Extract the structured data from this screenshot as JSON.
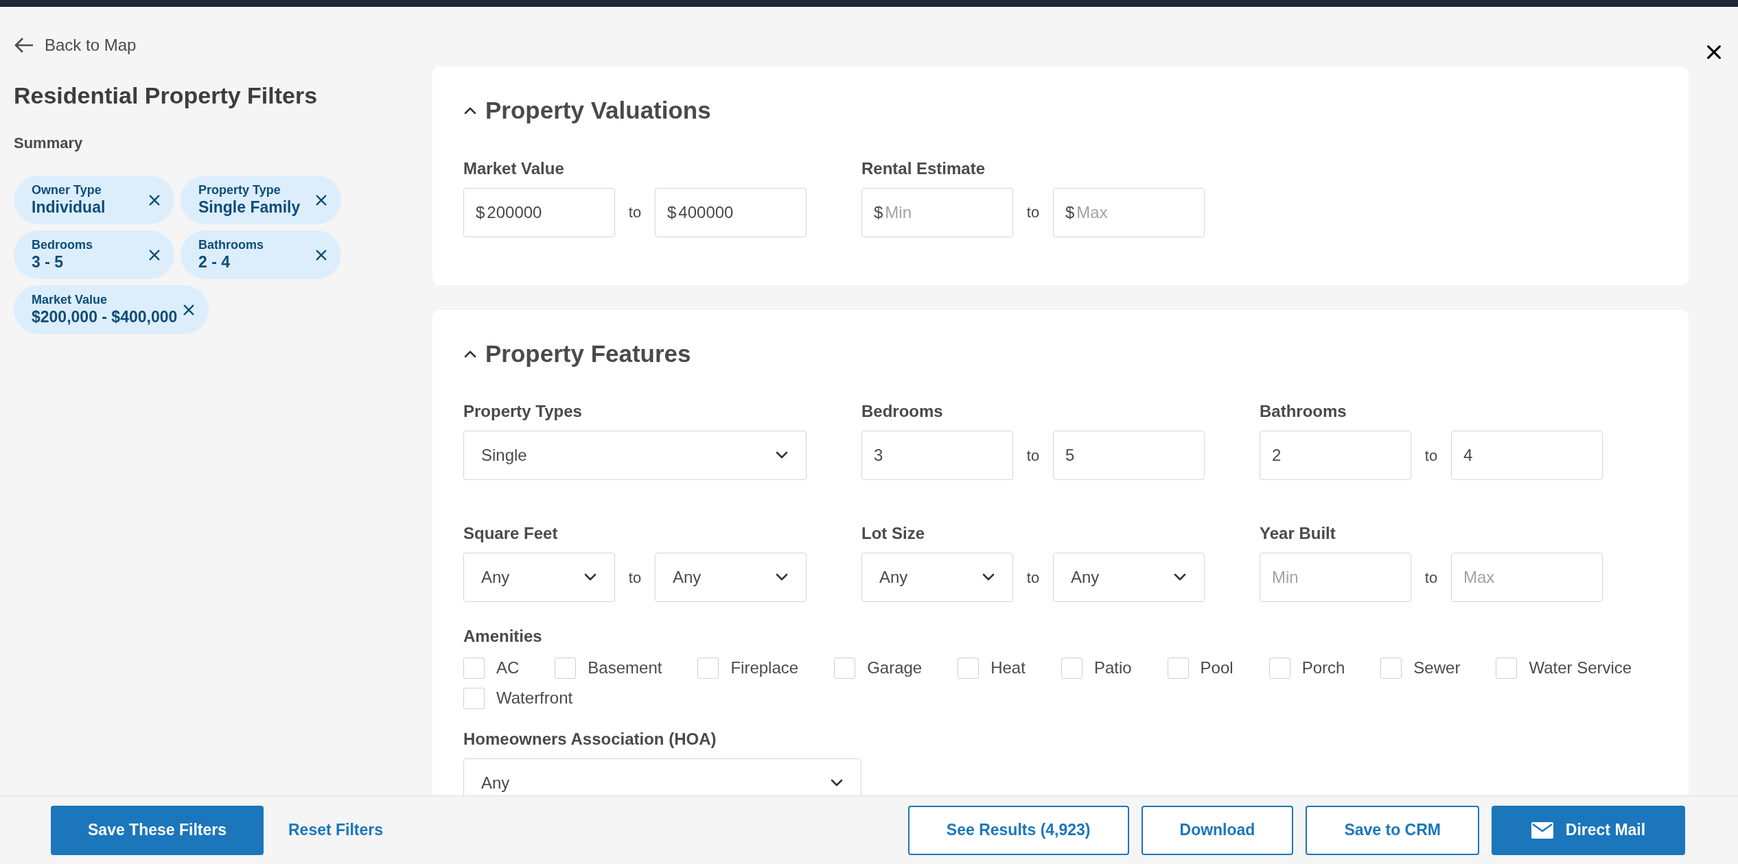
{
  "back_link": "Back to Map",
  "sidebar": {
    "title": "Residential Property Filters",
    "summary_heading": "Summary",
    "chips": [
      {
        "label": "Owner Type",
        "value": "Individual"
      },
      {
        "label": "Property Type",
        "value": "Single Family"
      },
      {
        "label": "Bedrooms",
        "value": "3 - 5"
      },
      {
        "label": "Bathrooms",
        "value": "2 - 4"
      },
      {
        "label": "Market Value",
        "value": "$200,000 - $400,000"
      }
    ]
  },
  "sections": [
    {
      "title": "Property Valuations",
      "expanded": true,
      "fields": [
        {
          "kind": "range_input",
          "label": "Market Value",
          "separator": "to",
          "from": {
            "prefix": "$",
            "value": "200000"
          },
          "to": {
            "prefix": "$",
            "value": "400000"
          }
        },
        {
          "kind": "range_input",
          "label": "Rental Estimate",
          "separator": "to",
          "from": {
            "prefix": "$",
            "placeholder": "Min"
          },
          "to": {
            "prefix": "$",
            "placeholder": "Max"
          }
        }
      ]
    },
    {
      "title": "Property Features",
      "expanded": true,
      "fields": [
        {
          "kind": "select",
          "label": "Property Types",
          "value": "Single"
        },
        {
          "kind": "range_input",
          "label": "Bedrooms",
          "separator": "to",
          "from": {
            "value": "3"
          },
          "to": {
            "value": "5"
          }
        },
        {
          "kind": "range_input",
          "label": "Bathrooms",
          "separator": "to",
          "from": {
            "value": "2"
          },
          "to": {
            "value": "4"
          }
        },
        {
          "kind": "range_select",
          "label": "Square Feet",
          "separator": "to",
          "from": {
            "value": "Any"
          },
          "to": {
            "value": "Any"
          }
        },
        {
          "kind": "range_select",
          "label": "Lot Size",
          "separator": "to",
          "from": {
            "value": "Any"
          },
          "to": {
            "value": "Any"
          }
        },
        {
          "kind": "range_input",
          "label": "Year Built",
          "separator": "to",
          "from": {
            "placeholder": "Min"
          },
          "to": {
            "placeholder": "Max"
          }
        },
        {
          "kind": "checkboxes",
          "label": "Amenities",
          "options": [
            {
              "label": "AC",
              "checked": false
            },
            {
              "label": "Basement",
              "checked": false
            },
            {
              "label": "Fireplace",
              "checked": false
            },
            {
              "label": "Garage",
              "checked": false
            },
            {
              "label": "Heat",
              "checked": false
            },
            {
              "label": "Patio",
              "checked": false
            },
            {
              "label": "Pool",
              "checked": false
            },
            {
              "label": "Porch",
              "checked": false
            },
            {
              "label": "Sewer",
              "checked": false
            },
            {
              "label": "Water Service",
              "checked": false
            },
            {
              "label": "Waterfront",
              "checked": false
            }
          ]
        },
        {
          "kind": "select",
          "label": "Homeowners Association (HOA)",
          "value": "Any",
          "wide": true
        }
      ]
    }
  ],
  "footer": {
    "left_buttons": [
      {
        "label": "Save These Filters",
        "kind": "primary"
      },
      {
        "label": "Reset Filters",
        "kind": "link"
      }
    ],
    "right_buttons": [
      {
        "label": "See Results (4,923)",
        "kind": "outline"
      },
      {
        "label": "Download",
        "kind": "outline"
      },
      {
        "label": "Save to CRM",
        "kind": "outline"
      },
      {
        "label": "Direct Mail",
        "kind": "primary_mail"
      }
    ]
  }
}
